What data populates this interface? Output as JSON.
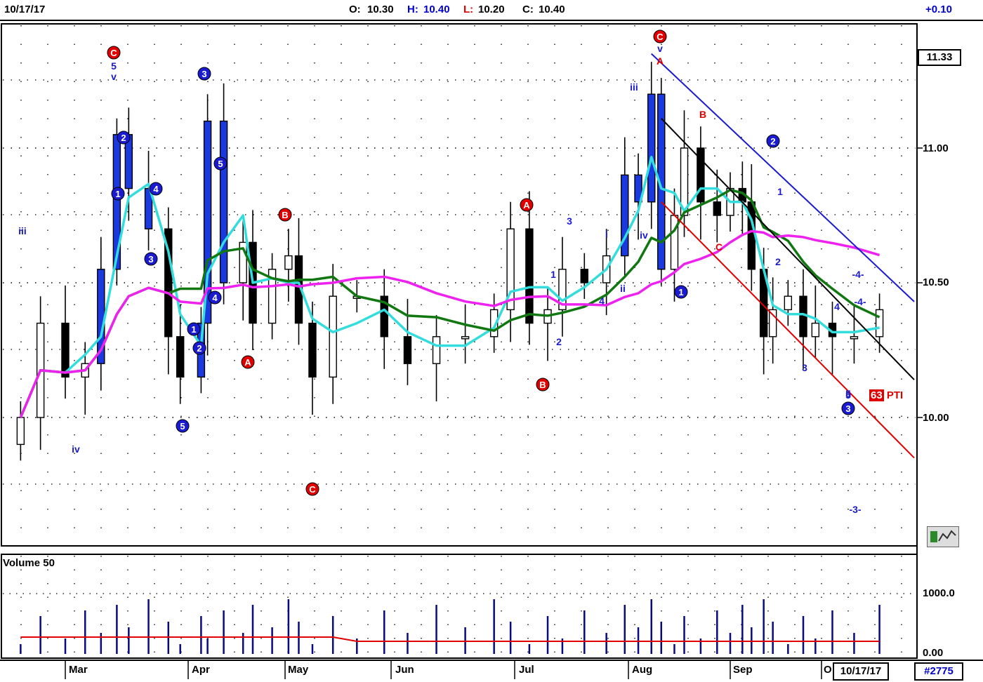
{
  "header": {
    "date": "10/17/17",
    "open_label": "O:",
    "open": "10.30",
    "high_label": "H:",
    "high": "10.40",
    "low_label": "L:",
    "low": "10.20",
    "close_label": "C:",
    "close": "10.40",
    "change": "+0.10"
  },
  "colors": {
    "up_bar": "#ffffff",
    "down_bar": "#000000",
    "impulse_bar": "#1a3ae0",
    "red_bar": "#e00000",
    "ma_short": "#33dddd",
    "ma_mid": "#117711",
    "ma_long": "#ee22ee",
    "channel_blue": "#1a1ad0",
    "channel_red": "#e00000",
    "wave_blue": "#1a1ad0",
    "wave_red": "#e00000",
    "volume_bar": "#0a0a80",
    "volume_avg": "#e00000"
  },
  "price_axis": {
    "ticks": [
      "11.00",
      "10.50",
      "10.00"
    ],
    "current_price": "11.33"
  },
  "volume_panel": {
    "title": "Volume 50",
    "ticks": [
      "1000.0",
      "0.00"
    ]
  },
  "months": [
    "Mar",
    "Apr",
    "May",
    "Jun",
    "Jul",
    "Aug",
    "Sep",
    "O"
  ],
  "current_date_box": "10/17/17",
  "chart_number": "#2775",
  "pti": {
    "value": "63",
    "label": "PTI"
  },
  "wave_labels": {
    "circled_red": [
      "C",
      "B",
      "A",
      "C",
      "A",
      "B",
      "C"
    ],
    "circled_blue": [
      "2",
      "1",
      "4",
      "3",
      "3",
      "5",
      "4",
      "1",
      "2",
      "5",
      "1",
      "2",
      "3"
    ],
    "plain": [
      "5",
      "v",
      "iii",
      "iv",
      "3",
      "i",
      "ii",
      "iii",
      "iv",
      "1",
      "2",
      "4",
      "5",
      "v",
      "A",
      "B",
      "C",
      "1",
      "2",
      "3",
      "4",
      "5",
      "-4-",
      "-4-",
      "-3-"
    ]
  },
  "chart_data": {
    "type": "ohlc",
    "title": "",
    "date_range": [
      "2017-02",
      "2017-10-17"
    ],
    "price_range": [
      9.6,
      11.55
    ],
    "ticks": [
      10.0,
      10.5,
      11.0
    ],
    "last_bar": {
      "open": 10.3,
      "high": 10.4,
      "low": 10.2,
      "close": 10.4,
      "change": 0.1
    },
    "overlays": [
      "short moving average (cyan)",
      "medium moving average (green)",
      "long moving average (magenta)",
      "descending channel (blue/red)",
      "trend line (black)"
    ],
    "series": [
      {
        "name": "price",
        "close_points": [
          [
            "2017-02-20",
            10.0
          ],
          [
            "2017-02-24",
            10.35
          ],
          [
            "2017-03-01",
            10.15
          ],
          [
            "2017-03-06",
            10.2
          ],
          [
            "2017-03-10",
            10.55
          ],
          [
            "2017-03-14",
            11.05
          ],
          [
            "2017-03-17",
            10.85
          ],
          [
            "2017-03-22",
            10.7
          ],
          [
            "2017-03-27",
            10.3
          ],
          [
            "2017-03-30",
            10.15
          ],
          [
            "2017-04-05",
            10.35
          ],
          [
            "2017-04-07",
            11.1
          ],
          [
            "2017-04-12",
            10.5
          ],
          [
            "2017-04-18",
            10.65
          ],
          [
            "2017-04-21",
            10.35
          ],
          [
            "2017-04-27",
            10.55
          ],
          [
            "2017-05-02",
            10.6
          ],
          [
            "2017-05-05",
            10.35
          ],
          [
            "2017-05-09",
            10.15
          ],
          [
            "2017-05-15",
            10.45
          ],
          [
            "2017-05-22",
            10.45
          ],
          [
            "2017-05-30",
            10.3
          ],
          [
            "2017-06-05",
            10.2
          ],
          [
            "2017-06-12",
            10.3
          ],
          [
            "2017-06-19",
            10.3
          ],
          [
            "2017-06-26",
            10.4
          ],
          [
            "2017-06-30",
            10.7
          ],
          [
            "2017-07-05",
            10.35
          ],
          [
            "2017-07-10",
            10.4
          ],
          [
            "2017-07-14",
            10.55
          ],
          [
            "2017-07-20",
            10.5
          ],
          [
            "2017-07-26",
            10.6
          ],
          [
            "2017-07-31",
            10.9
          ],
          [
            "2017-08-04",
            10.8
          ],
          [
            "2017-08-08",
            11.2
          ],
          [
            "2017-08-11",
            10.55
          ],
          [
            "2017-08-15",
            10.75
          ],
          [
            "2017-08-18",
            11.0
          ],
          [
            "2017-08-23",
            10.8
          ],
          [
            "2017-08-28",
            10.75
          ],
          [
            "2017-09-01",
            10.85
          ],
          [
            "2017-09-05",
            10.8
          ],
          [
            "2017-09-08",
            10.55
          ],
          [
            "2017-09-12",
            10.3
          ],
          [
            "2017-09-15",
            10.4
          ],
          [
            "2017-09-20",
            10.45
          ],
          [
            "2017-09-25",
            10.3
          ],
          [
            "2017-09-29",
            10.35
          ],
          [
            "2017-10-04",
            10.3
          ],
          [
            "2017-10-10",
            10.3
          ],
          [
            "2017-10-17",
            10.4
          ]
        ]
      },
      {
        "name": "volume",
        "note": "average line",
        "approx_range": [
          0,
          1200
        ]
      }
    ]
  }
}
